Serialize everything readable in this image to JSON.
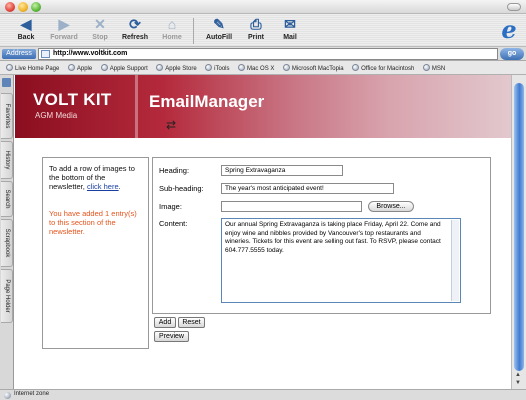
{
  "toolbar": {
    "back": "Back",
    "forward": "Forward",
    "stop": "Stop",
    "refresh": "Refresh",
    "home": "Home",
    "autofill": "AutoFill",
    "print": "Print",
    "mail": "Mail"
  },
  "address": {
    "label": "Address",
    "url": "http://www.voltkit.com",
    "go": "go"
  },
  "favorites": [
    "Live Home Page",
    "Apple",
    "Apple Support",
    "Apple Store",
    "iTools",
    "Mac OS X",
    "Microsoft MacTopia",
    "Office for Macintosh",
    "MSN"
  ],
  "sidebar_tabs": [
    "Favorites",
    "History",
    "Search",
    "Scrapbook",
    "Page Holder"
  ],
  "banner": {
    "logo": "VOLT KIT",
    "subtitle": "AGM Media",
    "title": "EmailManager"
  },
  "help": {
    "text": "To add a row of images to the bottom of the newsletter,",
    "link": "click here",
    "period": ".",
    "notice": "You have added 1 entry(s) to this section of the newsletter."
  },
  "form": {
    "heading_label": "Heading:",
    "heading_value": "Spring Extravaganza",
    "subheading_label": "Sub-heading:",
    "subheading_value": "The year's most anticipated event!",
    "image_label": "Image:",
    "image_value": "",
    "browse": "Browse...",
    "content_label": "Content:",
    "content_value": "Our annual Spring Extravaganza is taking place Friday, April 22. Come and enjoy wine and nibbles provided by Vancouver's top restaurants and wineries. Tickets for this event are selling out fast. To RSVP, please contact 604.777.5555 today."
  },
  "buttons": {
    "add": "Add",
    "reset": "Reset",
    "preview": "Preview"
  },
  "status": {
    "text": "Internet zone"
  }
}
